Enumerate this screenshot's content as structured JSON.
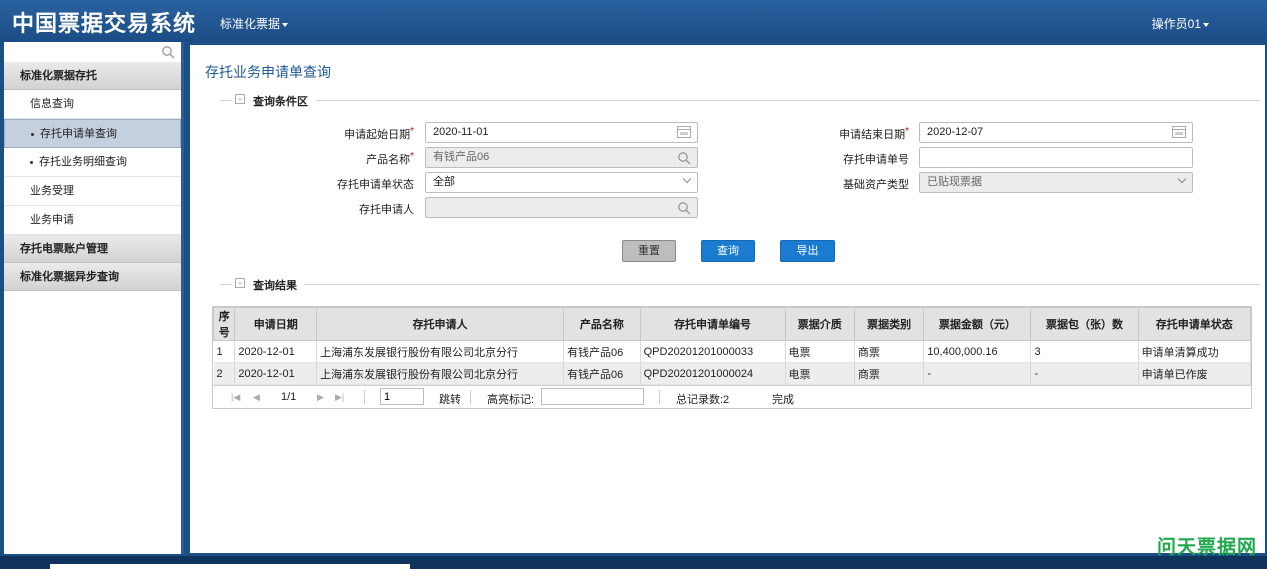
{
  "header": {
    "app_title": "中国票据交易系统",
    "nav_menu": "标准化票据",
    "user": "操作员01"
  },
  "sidebar": {
    "search_placeholder": "",
    "groups": [
      {
        "label": "标准化票据存托"
      },
      {
        "label": "存托电票账户管理"
      },
      {
        "label": "标准化票据异步查询"
      }
    ],
    "items": [
      {
        "label": "信息查询"
      },
      {
        "label": "存托申请单查询"
      },
      {
        "label": "存托业务明细查询"
      },
      {
        "label": "业务受理"
      },
      {
        "label": "业务申请"
      }
    ]
  },
  "main": {
    "page_title": "存托业务申请单查询",
    "query_section": "查询条件区",
    "result_section": "查询结果",
    "fields": {
      "start_date": {
        "label": "申请起始日期",
        "value": "2020-11-01"
      },
      "end_date": {
        "label": "申请结束日期",
        "value": "2020-12-07"
      },
      "product_name": {
        "label": "产品名称",
        "value": "有钱产品06"
      },
      "request_no": {
        "label": "存托申请单号",
        "value": ""
      },
      "request_status": {
        "label": "存托申请单状态",
        "value": "全部"
      },
      "asset_type": {
        "label": "基础资产类型",
        "value": "已贴现票据"
      },
      "applicant": {
        "label": "存托申请人",
        "value": ""
      }
    },
    "buttons": {
      "reset": "重置",
      "query": "查询",
      "export": "导出"
    },
    "table": {
      "columns": [
        "序号",
        "申请日期",
        "存托申请人",
        "产品名称",
        "存托申请单编号",
        "票据介质",
        "票据类别",
        "票据金额（元）",
        "票据包（张）数",
        "存托申请单状态"
      ],
      "rows": [
        [
          "1",
          "2020-12-01",
          "上海浦东发展银行股份有限公司北京分行",
          "有钱产品06",
          "QPD20201201000033",
          "电票",
          "商票",
          "10,400,000.16",
          "3",
          "申请单清算成功"
        ],
        [
          "2",
          "2020-12-01",
          "上海浦东发展银行股份有限公司北京分行",
          "有钱产品06",
          "QPD20201201000024",
          "电票",
          "商票",
          "-",
          "-",
          "申请单已作废"
        ]
      ]
    },
    "pager": {
      "page": "1/1",
      "page_input": "1",
      "jump": "跳转",
      "highlight_label": "高亮标记:",
      "highlight_value": "",
      "total": "总记录数:2",
      "status": "完成"
    }
  },
  "watermark": "问天票据网",
  "colors": {
    "header": "#1b4c84",
    "accent_blue": "#1a7bd0",
    "watermark": "#1fa84c"
  }
}
